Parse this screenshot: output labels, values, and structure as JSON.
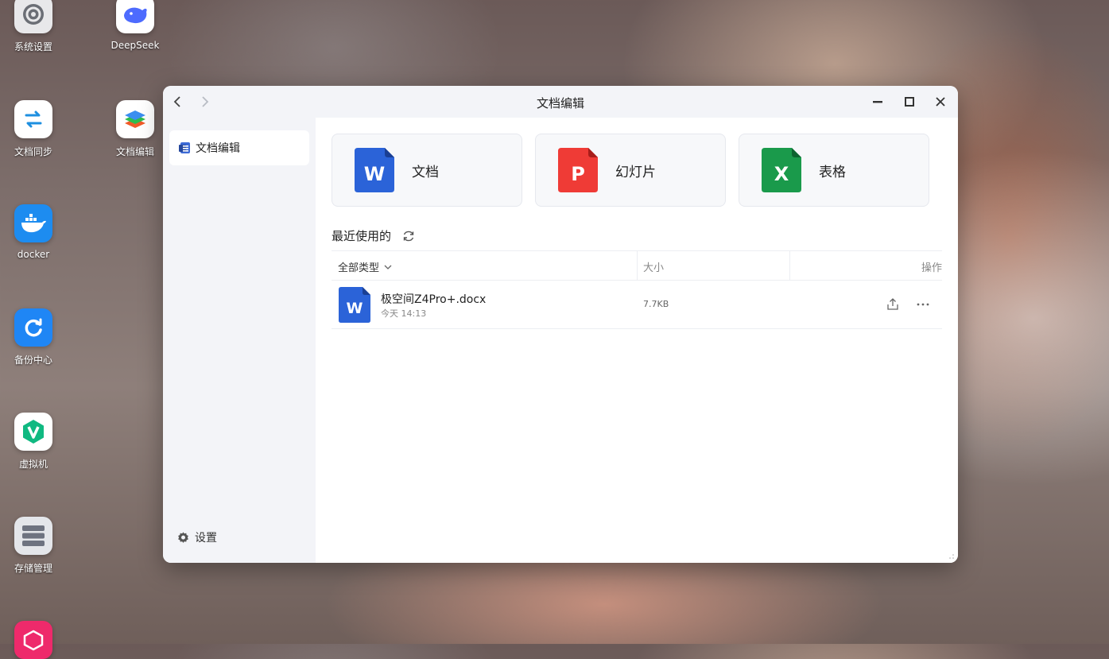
{
  "desktop": {
    "icons": [
      {
        "label": "系统设置",
        "icon": "gear-icon"
      },
      {
        "label": "DeepSeek",
        "icon": "whale-icon"
      },
      {
        "label": "文档同步",
        "icon": "sync-arrows-icon"
      },
      {
        "label": "文档编辑",
        "icon": "layers-icon"
      },
      {
        "label": "docker",
        "icon": "docker-whale-icon"
      },
      {
        "label": "备份中心",
        "icon": "backup-refresh-icon"
      },
      {
        "label": "虚拟机",
        "icon": "vm-v-icon"
      },
      {
        "label": "存储管理",
        "icon": "storage-disk-icon"
      },
      {
        "label": "",
        "icon": "box-icon"
      }
    ]
  },
  "window": {
    "title": "文档编辑",
    "sidebar": {
      "items": [
        {
          "label": "文档编辑",
          "icon": "document-icon"
        }
      ],
      "settings_label": "设置"
    },
    "create_cards": [
      {
        "label": "文档",
        "letter": "W",
        "color": "#2b63d8"
      },
      {
        "label": "幻灯片",
        "letter": "P",
        "color": "#ef3b36"
      },
      {
        "label": "表格",
        "letter": "X",
        "color": "#1a9a4b"
      }
    ],
    "recent": {
      "heading": "最近使用的",
      "columns": {
        "type": "全部类型",
        "size": "大小",
        "actions": "操作"
      },
      "files": [
        {
          "name": "极空间Z4Pro+.docx",
          "date": "今天 14:13",
          "size": "7.7KB",
          "letter": "W"
        }
      ]
    }
  },
  "colors": {
    "word": "#2b63d8",
    "ppt": "#ef3b36",
    "excel": "#1a9a4b",
    "sidebar_bg": "#f3f4f8"
  }
}
